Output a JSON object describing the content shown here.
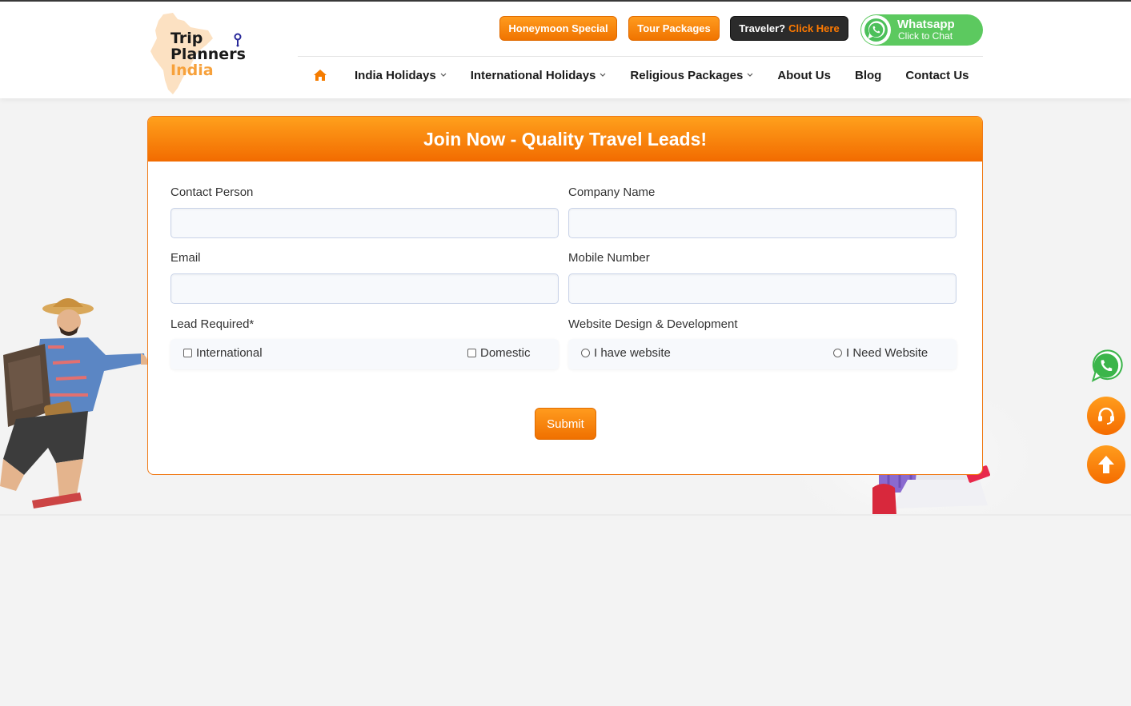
{
  "logo": {
    "line1": "Trip",
    "line2": "Planners",
    "line3": "India"
  },
  "top_buttons": {
    "honeymoon": "Honeymoon Special",
    "tour_packages": "Tour Packages",
    "traveler_prefix": "Traveler?",
    "traveler_link": "Click Here"
  },
  "whatsapp": {
    "title": "Whatsapp",
    "subtitle": "Click to Chat"
  },
  "nav": {
    "home_icon": "home-icon",
    "items": [
      {
        "label": "India Holidays",
        "dropdown": true
      },
      {
        "label": "International Holidays",
        "dropdown": true
      },
      {
        "label": "Religious Packages",
        "dropdown": true
      },
      {
        "label": "About Us",
        "dropdown": false
      },
      {
        "label": "Blog",
        "dropdown": false
      },
      {
        "label": "Contact Us",
        "dropdown": false
      }
    ]
  },
  "form": {
    "heading": "Join Now - Quality Travel Leads!",
    "contact_person_label": "Contact Person",
    "contact_person_value": "",
    "company_name_label": "Company Name",
    "company_name_value": "",
    "email_label": "Email",
    "email_value": "",
    "mobile_label": "Mobile Number",
    "mobile_value": "",
    "lead_required_label": "Lead Required*",
    "lead_options": [
      "International",
      "Domestic"
    ],
    "website_label": "Website Design & Development",
    "website_options": [
      "I have website",
      "I Need Website"
    ],
    "submit_label": "Submit"
  },
  "colors": {
    "accent": "#f57c00",
    "whatsapp": "#5cc95f",
    "dark": "#2b2b2b"
  },
  "floating_icons": [
    "whatsapp-icon",
    "headset-icon",
    "arrow-up-icon"
  ]
}
